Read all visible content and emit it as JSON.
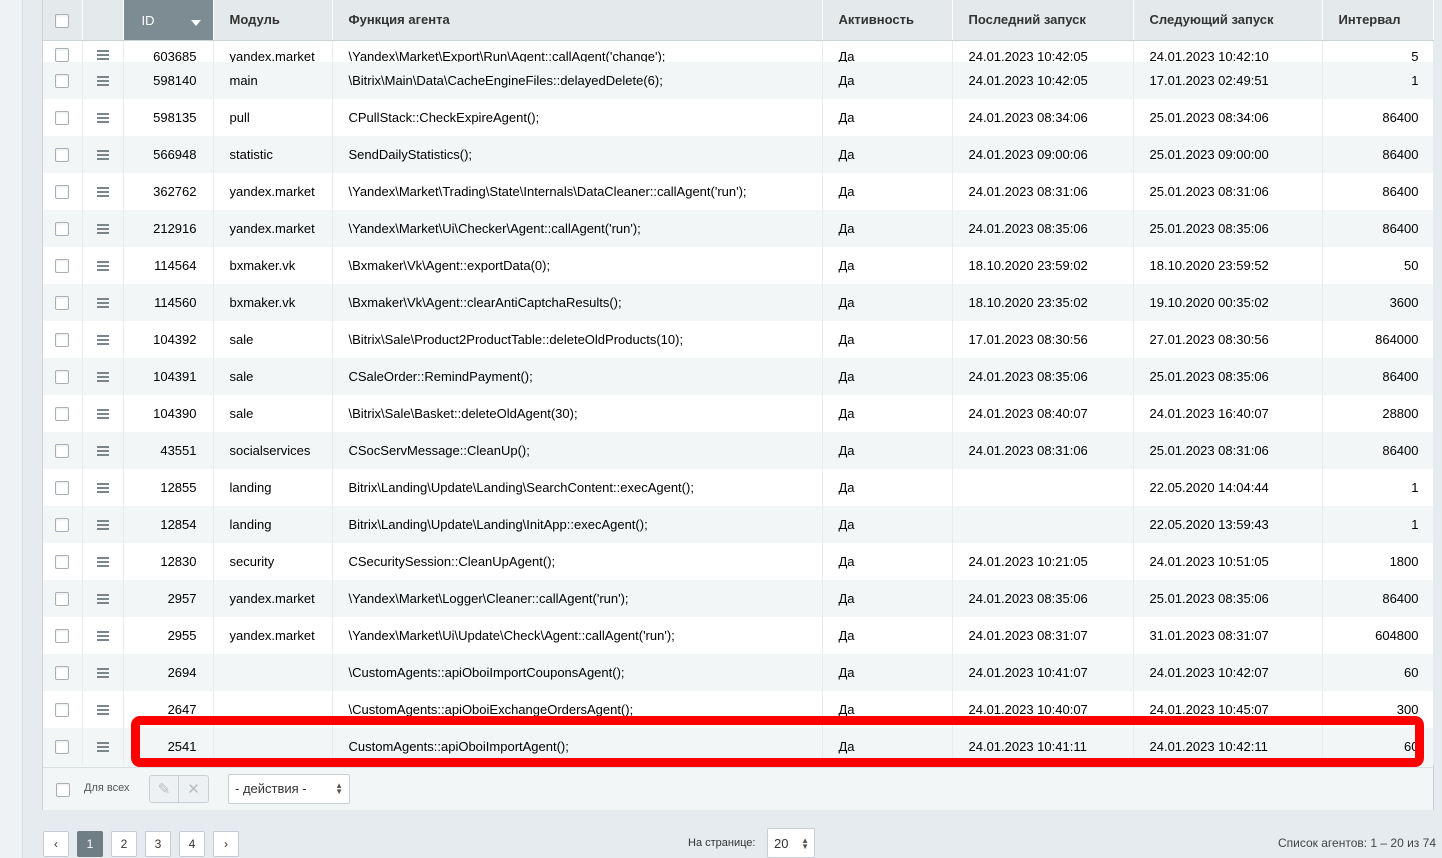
{
  "columns": {
    "id": "ID",
    "module": "Модуль",
    "function": "Функция агента",
    "active": "Активность",
    "last_run": "Последний запуск",
    "next_run": "Следующий запуск",
    "interval": "Интервал"
  },
  "partial_row": {
    "id": "603685",
    "module": "yandex.market",
    "function": "\\Yandex\\Market\\Export\\Run\\Agent::callAgent('change');",
    "active": "Да",
    "last_run": "24.01.2023 10:42:05",
    "next_run": "24.01.2023 10:42:10",
    "interval": "5"
  },
  "rows": [
    {
      "id": "598140",
      "module": "main",
      "function": "\\Bitrix\\Main\\Data\\CacheEngineFiles::delayedDelete(6);",
      "active": "Да",
      "last_run": "24.01.2023 10:42:05",
      "next_run": "17.01.2023 02:49:51",
      "interval": "1"
    },
    {
      "id": "598135",
      "module": "pull",
      "function": "CPullStack::CheckExpireAgent();",
      "active": "Да",
      "last_run": "24.01.2023 08:34:06",
      "next_run": "25.01.2023 08:34:06",
      "interval": "86400"
    },
    {
      "id": "566948",
      "module": "statistic",
      "function": "SendDailyStatistics();",
      "active": "Да",
      "last_run": "24.01.2023 09:00:06",
      "next_run": "25.01.2023 09:00:00",
      "interval": "86400"
    },
    {
      "id": "362762",
      "module": "yandex.market",
      "function": "\\Yandex\\Market\\Trading\\State\\Internals\\DataCleaner::callAgent('run');",
      "active": "Да",
      "last_run": "24.01.2023 08:31:06",
      "next_run": "25.01.2023 08:31:06",
      "interval": "86400"
    },
    {
      "id": "212916",
      "module": "yandex.market",
      "function": "\\Yandex\\Market\\Ui\\Checker\\Agent::callAgent('run');",
      "active": "Да",
      "last_run": "24.01.2023 08:35:06",
      "next_run": "25.01.2023 08:35:06",
      "interval": "86400"
    },
    {
      "id": "114564",
      "module": "bxmaker.vk",
      "function": "\\Bxmaker\\Vk\\Agent::exportData(0);",
      "active": "Да",
      "last_run": "18.10.2020 23:59:02",
      "next_run": "18.10.2020 23:59:52",
      "interval": "50"
    },
    {
      "id": "114560",
      "module": "bxmaker.vk",
      "function": "\\Bxmaker\\Vk\\Agent::clearAntiCaptchaResults();",
      "active": "Да",
      "last_run": "18.10.2020 23:35:02",
      "next_run": "19.10.2020 00:35:02",
      "interval": "3600"
    },
    {
      "id": "104392",
      "module": "sale",
      "function": "\\Bitrix\\Sale\\Product2ProductTable::deleteOldProducts(10);",
      "active": "Да",
      "last_run": "17.01.2023 08:30:56",
      "next_run": "27.01.2023 08:30:56",
      "interval": "864000"
    },
    {
      "id": "104391",
      "module": "sale",
      "function": "CSaleOrder::RemindPayment();",
      "active": "Да",
      "last_run": "24.01.2023 08:35:06",
      "next_run": "25.01.2023 08:35:06",
      "interval": "86400"
    },
    {
      "id": "104390",
      "module": "sale",
      "function": "\\Bitrix\\Sale\\Basket::deleteOldAgent(30);",
      "active": "Да",
      "last_run": "24.01.2023 08:40:07",
      "next_run": "24.01.2023 16:40:07",
      "interval": "28800"
    },
    {
      "id": "43551",
      "module": "socialservices",
      "function": "CSocServMessage::CleanUp();",
      "active": "Да",
      "last_run": "24.01.2023 08:31:06",
      "next_run": "25.01.2023 08:31:06",
      "interval": "86400"
    },
    {
      "id": "12855",
      "module": "landing",
      "function": "Bitrix\\Landing\\Update\\Landing\\SearchContent::execAgent();",
      "active": "Да",
      "last_run": "",
      "next_run": "22.05.2020 14:04:44",
      "interval": "1"
    },
    {
      "id": "12854",
      "module": "landing",
      "function": "Bitrix\\Landing\\Update\\Landing\\InitApp::execAgent();",
      "active": "Да",
      "last_run": "",
      "next_run": "22.05.2020 13:59:43",
      "interval": "1"
    },
    {
      "id": "12830",
      "module": "security",
      "function": "CSecuritySession::CleanUpAgent();",
      "active": "Да",
      "last_run": "24.01.2023 10:21:05",
      "next_run": "24.01.2023 10:51:05",
      "interval": "1800"
    },
    {
      "id": "2957",
      "module": "yandex.market",
      "function": "\\Yandex\\Market\\Logger\\Cleaner::callAgent('run');",
      "active": "Да",
      "last_run": "24.01.2023 08:35:06",
      "next_run": "25.01.2023 08:35:06",
      "interval": "86400"
    },
    {
      "id": "2955",
      "module": "yandex.market",
      "function": "\\Yandex\\Market\\Ui\\Update\\Check\\Agent::callAgent('run');",
      "active": "Да",
      "last_run": "24.01.2023 08:31:07",
      "next_run": "31.01.2023 08:31:07",
      "interval": "604800"
    },
    {
      "id": "2694",
      "module": "",
      "function": "\\CustomAgents::apiOboiImportCouponsAgent();",
      "active": "Да",
      "last_run": "24.01.2023 10:41:07",
      "next_run": "24.01.2023 10:42:07",
      "interval": "60"
    },
    {
      "id": "2647",
      "module": "",
      "function": "\\CustomAgents::apiOboiExchangeOrdersAgent();",
      "active": "Да",
      "last_run": "24.01.2023 10:40:07",
      "next_run": "24.01.2023 10:45:07",
      "interval": "300"
    },
    {
      "id": "2541",
      "module": "",
      "function": "CustomAgents::apiOboiImportAgent();",
      "active": "Да",
      "last_run": "24.01.2023 10:41:11",
      "next_run": "24.01.2023 10:42:11",
      "interval": "60"
    }
  ],
  "footer": {
    "for_all": "Для всех",
    "actions_select": "- действия -"
  },
  "pagination": {
    "prev": "‹",
    "pages": [
      "1",
      "2",
      "3",
      "4"
    ],
    "active_page": "1",
    "next": "›",
    "per_page_label": "На странице:",
    "per_page_value": "20",
    "summary": "Список агентов: 1 – 20 из 74"
  },
  "highlight": {
    "row_id": "2541",
    "color": "#ff0000"
  },
  "icons": {
    "row_menu": "hamburger-icon",
    "edit": "pencil-icon",
    "delete": "cross-icon",
    "sort": "sort-desc-icon"
  }
}
